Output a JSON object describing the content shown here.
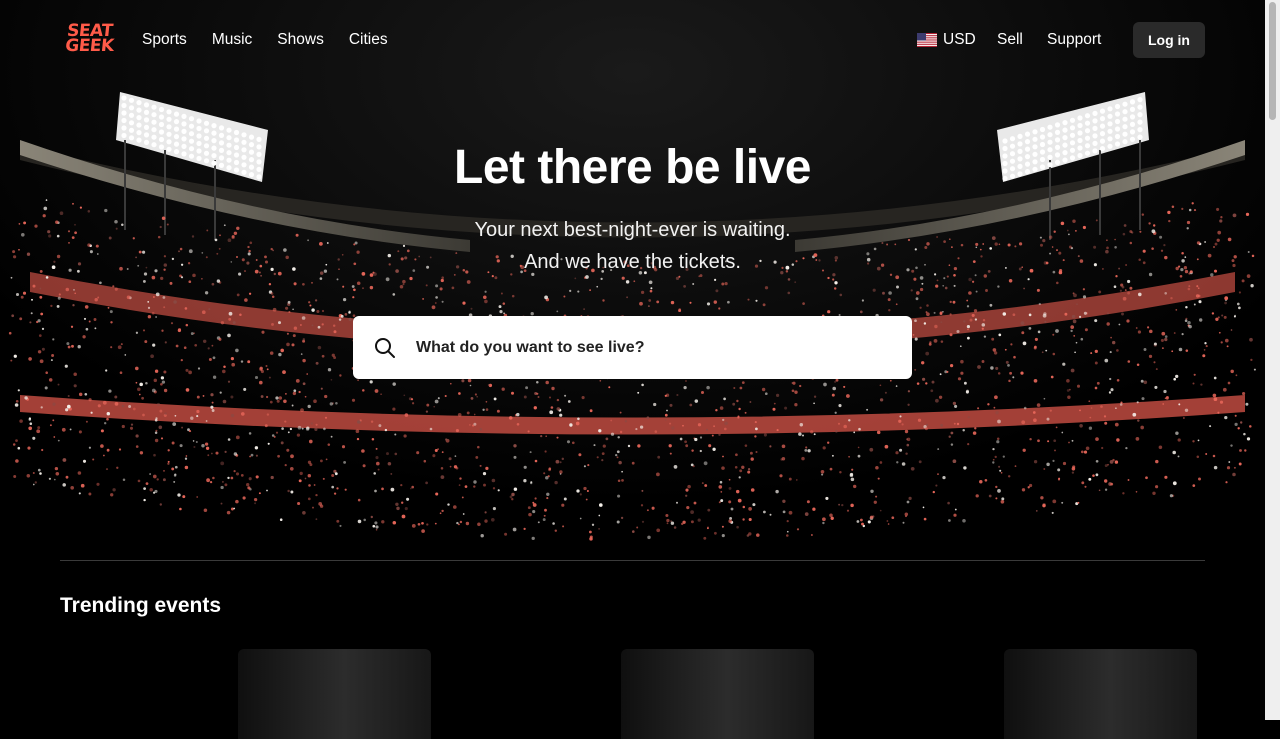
{
  "header": {
    "logo_line1": "SEAT",
    "logo_line2": "GEEK",
    "nav": [
      "Sports",
      "Music",
      "Shows",
      "Cities"
    ],
    "currency": "USD",
    "sell": "Sell",
    "support": "Support",
    "login": "Log in"
  },
  "hero": {
    "title": "Let there be live",
    "subtitle_line1": "Your next best-night-ever is waiting.",
    "subtitle_line2": "And we have the tickets.",
    "search_placeholder": "What do you want to see live?"
  },
  "trending": {
    "title": "Trending events"
  },
  "colors": {
    "brand": "#ff5b49",
    "background": "#000000",
    "button_bg": "#2a2a2a"
  }
}
